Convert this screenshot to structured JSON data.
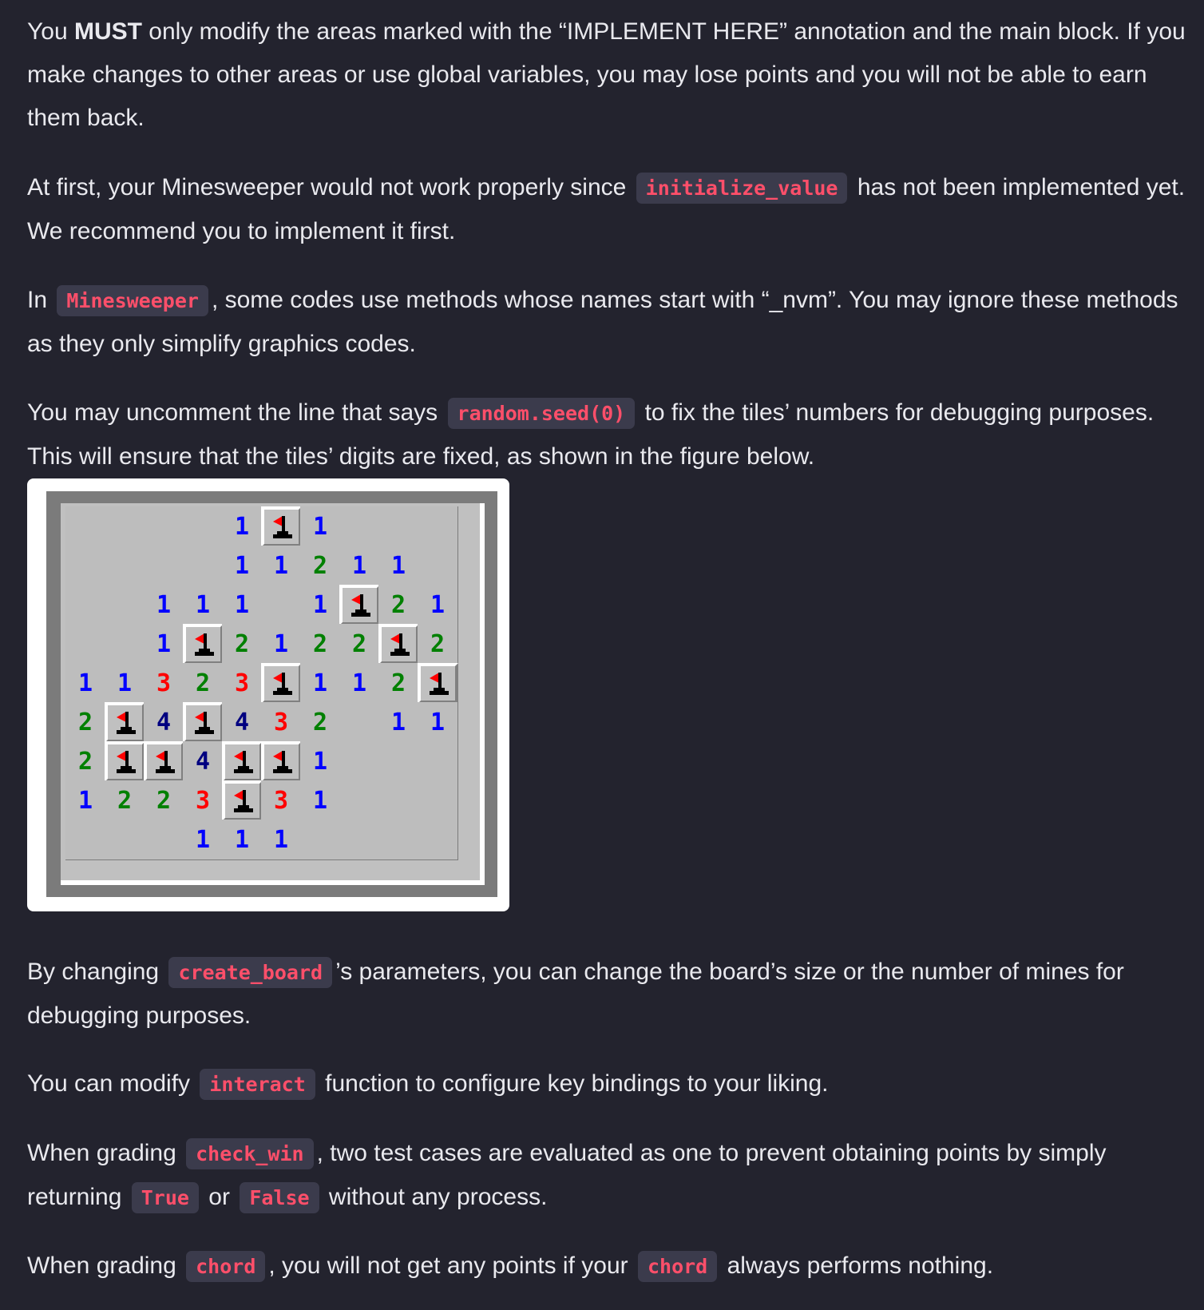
{
  "paragraphs": [
    {
      "segments": [
        {
          "t": "text",
          "v": "You "
        },
        {
          "t": "bold",
          "v": "MUST"
        },
        {
          "t": "text",
          "v": " only modify the areas marked with the “IMPLEMENT HERE” annotation and the main block. If you make changes to other areas or use global variables, you may lose points and you will not be able to earn them back."
        }
      ]
    },
    {
      "segments": [
        {
          "t": "text",
          "v": "At first, your Minesweeper would not work properly since "
        },
        {
          "t": "code",
          "v": "initialize_value"
        },
        {
          "t": "text",
          "v": " has not been implemented yet. We recommend you to implement it first."
        }
      ]
    },
    {
      "segments": [
        {
          "t": "text",
          "v": "In "
        },
        {
          "t": "code",
          "v": "Minesweeper"
        },
        {
          "t": "text",
          "v": ", some codes use methods whose names start with “_nvm”. You may ignore these methods as they only simplify graphics codes."
        }
      ]
    },
    {
      "segments": [
        {
          "t": "text",
          "v": "You may uncomment the line that says "
        },
        {
          "t": "code",
          "v": "random.seed(0)"
        },
        {
          "t": "text",
          "v": " to fix the tiles’ numbers for debugging purposes. This will ensure that the tiles’ digits are fixed, as shown in the figure below."
        }
      ]
    },
    {
      "segments": [
        {
          "t": "text",
          "v": "By changing "
        },
        {
          "t": "code",
          "v": "create_board"
        },
        {
          "t": "text",
          "v": "’s parameters, you can change the board’s size or the number of mines for debugging purposes."
        }
      ]
    },
    {
      "segments": [
        {
          "t": "text",
          "v": "You can modify "
        },
        {
          "t": "code",
          "v": "interact"
        },
        {
          "t": "text",
          "v": " function to configure key bindings to your liking."
        }
      ]
    },
    {
      "segments": [
        {
          "t": "text",
          "v": "When grading "
        },
        {
          "t": "code",
          "v": "check_win"
        },
        {
          "t": "text",
          "v": ", two test cases are evaluated as one to prevent obtaining points by simply returning "
        },
        {
          "t": "code",
          "v": "True"
        },
        {
          "t": "text",
          "v": " or "
        },
        {
          "t": "code",
          "v": "False"
        },
        {
          "t": "text",
          "v": " without any process."
        }
      ]
    },
    {
      "segments": [
        {
          "t": "text",
          "v": "When grading "
        },
        {
          "t": "code",
          "v": "chord"
        },
        {
          "t": "text",
          "v": ", you will not get any points if your "
        },
        {
          "t": "code",
          "v": "chord"
        },
        {
          "t": "text",
          "v": " always performs nothing."
        }
      ]
    }
  ],
  "minesweeper_board": [
    [
      "",
      "",
      "",
      "",
      "1",
      "F",
      "1",
      "",
      "",
      ""
    ],
    [
      "",
      "",
      "",
      "",
      "1",
      "1",
      "2",
      "1",
      "1",
      ""
    ],
    [
      "",
      "",
      "1",
      "1",
      "1",
      "",
      "1",
      "F",
      "2",
      "1"
    ],
    [
      "",
      "",
      "1",
      "F",
      "2",
      "1",
      "2",
      "2",
      "F",
      "2"
    ],
    [
      "1",
      "1",
      "3",
      "2",
      "3",
      "F",
      "1",
      "1",
      "2",
      "F"
    ],
    [
      "2",
      "F",
      "4",
      "F",
      "4",
      "3",
      "2",
      "",
      "1",
      "1"
    ],
    [
      "2",
      "F",
      "F",
      "4",
      "F",
      "F",
      "1",
      "",
      "",
      ""
    ],
    [
      "1",
      "2",
      "2",
      "3",
      "F",
      "3",
      "1",
      "",
      "",
      ""
    ],
    [
      "",
      "",
      "",
      "1",
      "1",
      "1",
      "",
      "",
      "",
      ""
    ]
  ],
  "colors": {
    "background": "#23232e",
    "text": "#e9e9ee",
    "code_text": "#ff4f6a",
    "code_bg": "#3b3b4c",
    "flag_red": "#ff0000"
  },
  "icons": {
    "flag": "flag-icon"
  }
}
